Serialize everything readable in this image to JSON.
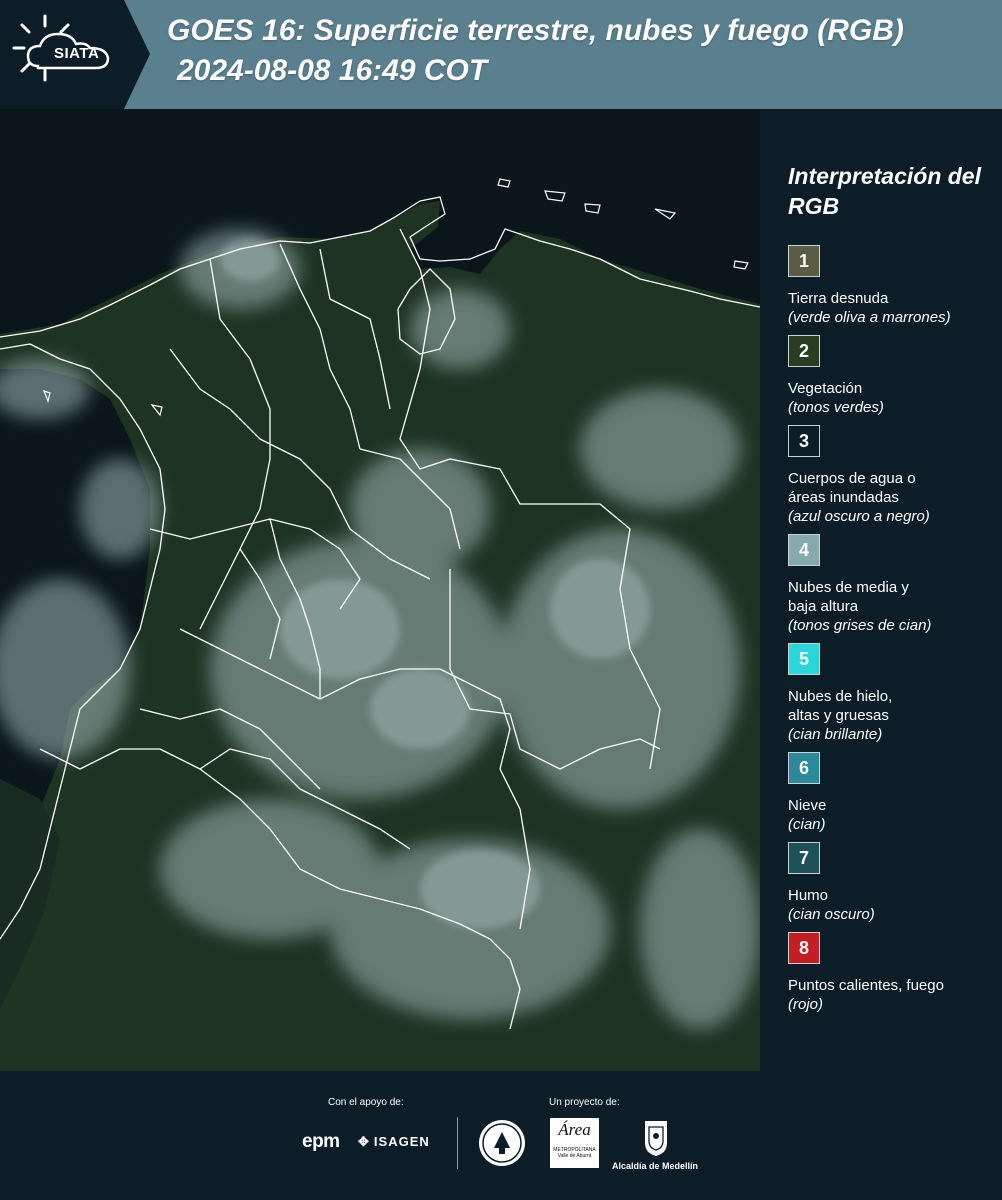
{
  "header": {
    "logo_text": "SIATA",
    "title_line1": "GOES 16: Superficie terrestre, nubes y fuego (RGB)",
    "title_line2": "2024-08-08 16:49 COT",
    "bg_color": "#5a7f8e",
    "logo_panel_color": "#0c1d28"
  },
  "map": {
    "ocean_color": "#0a1619",
    "land_color": "#1f3322",
    "cloud_color": "#9fb6b8",
    "border_color": "#ffffff"
  },
  "legend": {
    "title": "Interpretación del RGB",
    "items": [
      {
        "number": "1",
        "label": "Tierra desnuda",
        "desc": "(verde oliva a marrones)",
        "color": "#5a5c44"
      },
      {
        "number": "2",
        "label": "Vegetación",
        "desc": "(tonos verdes)",
        "color": "#2a3d22"
      },
      {
        "number": "3",
        "label": "Cuerpos de agua o\náreas inundadas",
        "desc": "(azul oscuro a negro)",
        "color": "#0c1d28"
      },
      {
        "number": "4",
        "label": "Nubes de media y\nbaja altura",
        "desc": "(tonos grises de cian)",
        "color": "#86a9ac"
      },
      {
        "number": "5",
        "label": "Nubes de hielo,\naltas y gruesas",
        "desc": "(cian brillante)",
        "color": "#2ad6d8"
      },
      {
        "number": "6",
        "label": "Nieve",
        "desc": "(cian)",
        "color": "#2a8a9c"
      },
      {
        "number": "7",
        "label": "Humo",
        "desc": "(cian oscuro)",
        "color": "#1e5258"
      },
      {
        "number": "8",
        "label": "Puntos calientes, fuego",
        "desc": "(rojo)",
        "color": "#c41e22"
      }
    ]
  },
  "footer": {
    "support_caption": "Con el apoyo de:",
    "project_caption": "Un proyecto de:",
    "epm_logo": "epm",
    "isagen_logo": "ISAGEN",
    "area_logo": "Área",
    "area_sub": "METROPOLITANA Valle de Aburrá",
    "alcaldia_logo": "Alcaldía de Medellín"
  }
}
